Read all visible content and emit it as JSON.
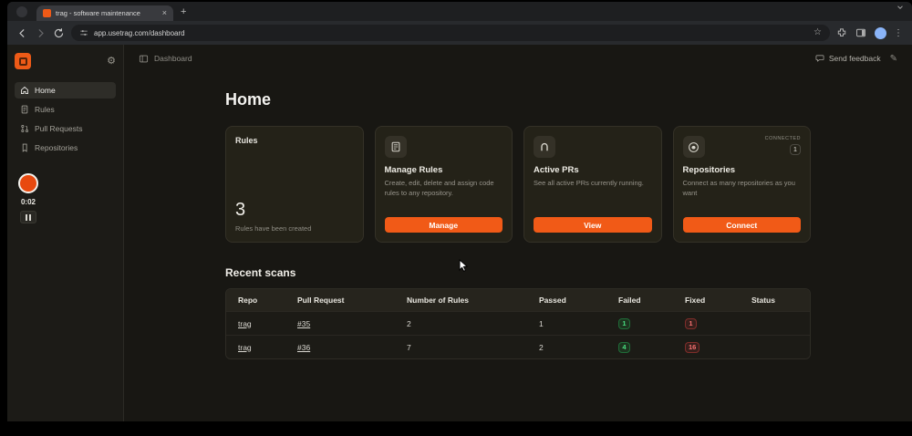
{
  "browser": {
    "tab_title": "trag - software maintenance",
    "url": "app.usetrag.com/dashboard"
  },
  "sidebar": {
    "items": [
      {
        "label": "Home"
      },
      {
        "label": "Rules"
      },
      {
        "label": "Pull Requests"
      },
      {
        "label": "Repositories"
      }
    ]
  },
  "recorder": {
    "time": "0:02"
  },
  "topbar": {
    "breadcrumb": "Dashboard",
    "feedback": "Send feedback"
  },
  "main": {
    "title": "Home",
    "cards": {
      "rules": {
        "label": "Rules",
        "count": "3",
        "caption": "Rules have been created"
      },
      "manage_rules": {
        "title": "Manage Rules",
        "description": "Create, edit, delete and assign code rules to any repository.",
        "button": "Manage"
      },
      "active_prs": {
        "title": "Active PRs",
        "description": "See all active PRs currently running.",
        "button": "View"
      },
      "repositories": {
        "title": "Repositories",
        "description": "Connect as many repositories as you want",
        "button": "Connect",
        "connected_label": "CONNECTED",
        "connected_count": "1"
      }
    },
    "recent_scans": {
      "title": "Recent scans",
      "columns": [
        "Repo",
        "Pull Request",
        "Number of Rules",
        "Passed",
        "Failed",
        "Fixed",
        "Status"
      ],
      "rows": [
        {
          "repo": "trag",
          "pull_request": "#35",
          "rules": "2",
          "passed": "1",
          "failed": "1",
          "fixed": "1"
        },
        {
          "repo": "trag",
          "pull_request": "#36",
          "rules": "7",
          "passed": "2",
          "failed": "4",
          "fixed": "16"
        }
      ]
    }
  },
  "colors": {
    "accent": "#f05a17",
    "success": "#34d27b",
    "danger": "#f87171"
  }
}
